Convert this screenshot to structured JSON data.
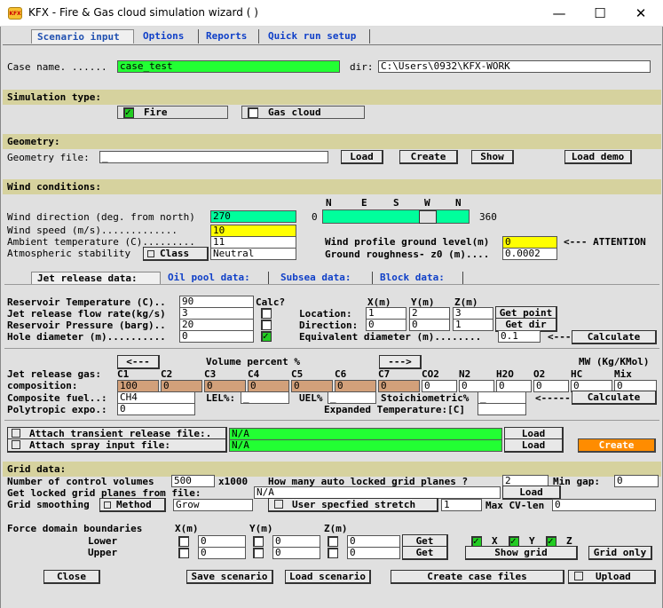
{
  "window": {
    "title": "KFX - Fire & Gas cloud simulation wizard ( )",
    "icon": "kfx-app-icon",
    "minimize": "—",
    "maximize": "☐",
    "close": "✕"
  },
  "tabs": [
    "Scenario input",
    "Options",
    "Reports",
    "Quick run setup"
  ],
  "case": {
    "label": "Case name. ......",
    "value": "case_test",
    "dir_label": "dir:",
    "dir_value": "C:\\Users\\0932\\KFX-WORK"
  },
  "sim_type": {
    "heading": "Simulation type:",
    "fire": "Fire",
    "gas_cloud": "Gas cloud"
  },
  "geometry": {
    "heading": "Geometry:",
    "file_label": "Geometry file:",
    "file_value": "_",
    "load": "Load",
    "create": "Create",
    "show": "Show",
    "load_demo": "Load demo"
  },
  "wind": {
    "heading": "Wind conditions:",
    "compass": [
      "N",
      "E",
      "S",
      "W",
      "N"
    ],
    "direction_label": "Wind direction (deg. from north)",
    "direction_value": "270",
    "dir_min": "0",
    "dir_max": "360",
    "dir_fraction": 0.75,
    "speed_label": "Wind speed  (m/s).............",
    "speed_value": "10",
    "ambient_label": "Ambient temperature (C).........",
    "ambient_value": "11",
    "stability_label": "Atmospheric stability",
    "stability_btn": "Class",
    "stability_value": "Neutral",
    "profile_label": "Wind profile ground level(m)",
    "profile_value": "0",
    "attention": "<--- ATTENTION",
    "roughness_label": "Ground roughness- z0 (m)....",
    "roughness_value": "0.0002"
  },
  "subtabs": [
    "Jet release data:",
    "Oil pool data:",
    "Subsea data:",
    "Block data:"
  ],
  "jet": {
    "res_temp_label": "Reservoir Temperature (C)..",
    "res_temp_value": "90",
    "flow_label": "Jet release flow rate(kg/s)",
    "flow_value": "3",
    "pressure_label": "Reservoir Pressure (barg)..",
    "pressure_value": "20",
    "hole_label": "Hole diameter (m)..........",
    "hole_value": "0",
    "calc_label": "Calc?",
    "xyz_headers": [
      "X(m)",
      "Y(m)",
      "Z(m)"
    ],
    "location_label": "Location:",
    "location": [
      "1",
      "2",
      "3"
    ],
    "get_point": "Get point",
    "direction_label": "Direction:",
    "direction": [
      "0",
      "0",
      "1"
    ],
    "get_dir": "Get dir",
    "equiv_label": "Equivalent diameter (m)........",
    "equiv_value": "0.1",
    "arrow": "<---",
    "calculate": "Calculate",
    "prev": "<---",
    "next": "--->",
    "volume_label": "Volume percent %",
    "mw_label": "MW (Kg/KMol)",
    "gas_label": "Jet release gas:",
    "gas_cols": [
      "C1",
      "C2",
      "C3",
      "C4",
      "C5",
      "C6",
      "C7",
      "CO2",
      "N2",
      "H2O",
      "O2",
      "HC",
      "Mix"
    ],
    "comp_label": "composition:",
    "comp_values": [
      "100",
      "0",
      "0",
      "0",
      "0",
      "0",
      "0",
      "0",
      "0",
      "0",
      "0",
      "0",
      "0"
    ],
    "composite_label": "Composite fuel..:",
    "composite_value": "CH4",
    "lel_label": "LEL%:",
    "lel_value": "_",
    "uel_label": "UEL%",
    "uel_value": "_",
    "stoich_label": "Stoichiometric%",
    "stoich_value": "_",
    "stoich_arrow": "<-----",
    "stoich_calc": "Calculate",
    "poly_label": "Polytropic expo.:",
    "poly_value": "0",
    "exp_temp_label": "Expanded Temperature:[C]",
    "exp_temp_value": ""
  },
  "attach": {
    "transient_label": "Attach transient release file:.",
    "transient_value": "N/A",
    "transient_load": "Load",
    "spray_label": "Attach spray input file:",
    "spray_value": "N/A",
    "spray_load": "Load",
    "create": "Create"
  },
  "grid": {
    "heading": "Grid data:",
    "cv_label": "Number of control volumes",
    "cv_value": "500",
    "cv_unit": "x1000",
    "auto_label": "How many auto locked grid planes ?",
    "auto_value": "2",
    "min_gap_label": "Min gap:",
    "min_gap_value": "0",
    "locked_label": "Get locked grid planes from file:",
    "locked_value": "N/A",
    "locked_load": "Load",
    "smooth_label": "Grid smoothing",
    "method_btn": "Method",
    "method_value": "Grow",
    "stretch_label": "User specfied stretch",
    "stretch_value": "1",
    "maxcv_label": "Max CV-len",
    "maxcv_value": "0",
    "force_label": "Force domain boundaries",
    "xyz_headers": [
      "X(m)",
      "Y(m)",
      "Z(m)"
    ],
    "lower_label": "Lower",
    "lower": [
      "0",
      "0",
      "0"
    ],
    "upper_label": "Upper",
    "upper": [
      "0",
      "0",
      "0"
    ],
    "get": "Get",
    "axes": [
      "X",
      "Y",
      "Z"
    ],
    "show_grid": "Show grid",
    "grid_only": "Grid only"
  },
  "footer": {
    "close": "Close",
    "save": "Save scenario",
    "load": "Load scenario",
    "create_files": "Create case files",
    "upload": "Upload"
  },
  "colors": {
    "band": "#d6d29e",
    "tab_text": "#1040c8",
    "green_field": "#22ff33",
    "cyan_field": "#00ff9c",
    "yellow_field": "#ffff00",
    "comp_field": "#d2a07a",
    "create_btn": "#ff8c00"
  }
}
